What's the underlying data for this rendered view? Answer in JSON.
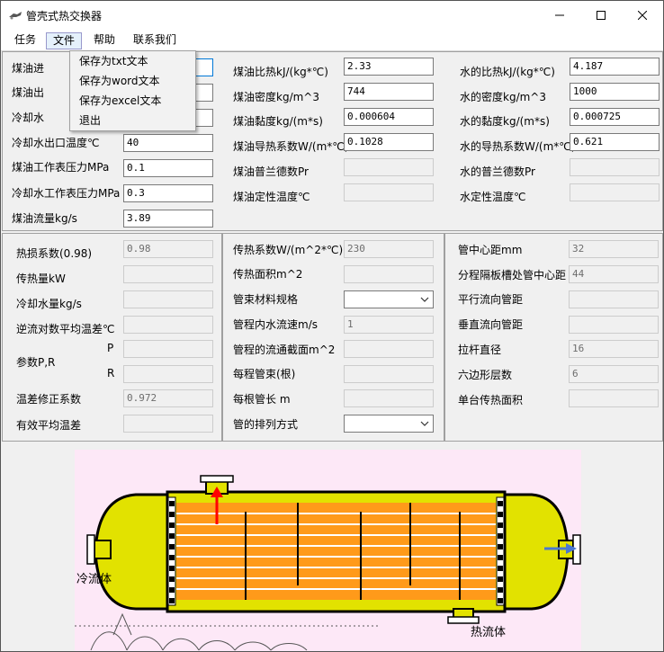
{
  "window": {
    "title": "管壳式热交换器",
    "accent": "#0078d7"
  },
  "menubar": {
    "items": [
      "任务",
      "文件",
      "帮助",
      "联系我们"
    ]
  },
  "file_menu": {
    "items": [
      "保存为txt文本",
      "保存为word文本",
      "保存为excel文本",
      "退出"
    ]
  },
  "top": {
    "left": [
      {
        "label": "煤油进",
        "value": ""
      },
      {
        "label": "煤油出",
        "value": ""
      },
      {
        "label": "冷却水",
        "value": ""
      },
      {
        "label": "冷却水出口温度℃",
        "value": "40"
      },
      {
        "label": "煤油工作表压力MPa",
        "value": "0.1"
      },
      {
        "label": "冷却水工作表压力MPa",
        "value": "0.3"
      },
      {
        "label": "煤油流量kg/s",
        "value": "3.89"
      }
    ],
    "middle": [
      {
        "label": "煤油比热kJ/(kg*℃)",
        "value": "2.33"
      },
      {
        "label": "煤油密度kg/m^3",
        "value": "744"
      },
      {
        "label": "煤油黏度kg/(m*s)",
        "value": "0.000604"
      },
      {
        "label": "煤油导热系数W/(m*℃)",
        "value": "0.1028"
      },
      {
        "label": "煤油普兰德数Pr",
        "value": ""
      },
      {
        "label": "煤油定性温度℃",
        "value": ""
      }
    ],
    "right": [
      {
        "label": "水的比热kJ/(kg*℃)",
        "value": "4.187"
      },
      {
        "label": "水的密度kg/m^3",
        "value": "1000"
      },
      {
        "label": "水的黏度kg/(m*s)",
        "value": "0.000725"
      },
      {
        "label": "水的导热系数W/(m*℃)",
        "value": "0.621"
      },
      {
        "label": "水的普兰德数Pr",
        "value": ""
      },
      {
        "label": "水定性温度℃",
        "value": ""
      }
    ]
  },
  "calc": {
    "left": {
      "heat_loss_label": "热损系数(0.98)",
      "heat_loss_value": "0.98",
      "heat_transfer_label": "传热量kW",
      "heat_transfer_value": "",
      "cooling_water_label": "冷却水量kg/s",
      "cooling_water_value": "",
      "lmtd_label": "逆流对数平均温差℃",
      "lmtd_value": "",
      "params_label": "参数P,R",
      "p_label": "P",
      "p_value": "",
      "r_label": "R",
      "r_value": "",
      "correction_label": "温差修正系数",
      "correction_value": "0.972",
      "effective_label": "有效平均温差",
      "effective_value": ""
    },
    "middle": {
      "coef_label": "传热系数W/(m^2*℃)",
      "coef_value": "230",
      "area_label": "传热面积m^2",
      "area_value": "",
      "tube_spec_label": "管束材料规格",
      "tube_spec_value": "",
      "velocity_label": "管程内水流速m/s",
      "velocity_value": "1",
      "flow_section_label": "管程的流通截面m^2",
      "flow_section_value": "",
      "bundles_label": "每程管束(根)",
      "bundles_value": "",
      "tube_len_label": "每根管长 m",
      "tube_len_value": "",
      "arrangement_label": "管的排列方式",
      "arrangement_value": ""
    },
    "right": {
      "pitch_label": "管中心距mm",
      "pitch_value": "32",
      "baffle_pitch_label": "分程隔板槽处管中心距",
      "baffle_pitch_value": "44",
      "parallel_label": "平行流向管距",
      "parallel_value": "",
      "vertical_label": "垂直流向管距",
      "vertical_value": "",
      "rod_label": "拉杆直径",
      "rod_value": "16",
      "hex_label": "六边形层数",
      "hex_value": "6",
      "unit_area_label": "单台传热面积",
      "unit_area_value": ""
    }
  },
  "diagram": {
    "cold_fluid_label": "冷流体",
    "hot_fluid_label": "热流体",
    "colors": {
      "background": "#fde8f7",
      "shell": "#e2e200",
      "tubes": "#ff9a1a",
      "tube_lines": "#ffffff",
      "hot_arrow": "#ff0000",
      "cold_arrow": "#4a78d0"
    }
  }
}
